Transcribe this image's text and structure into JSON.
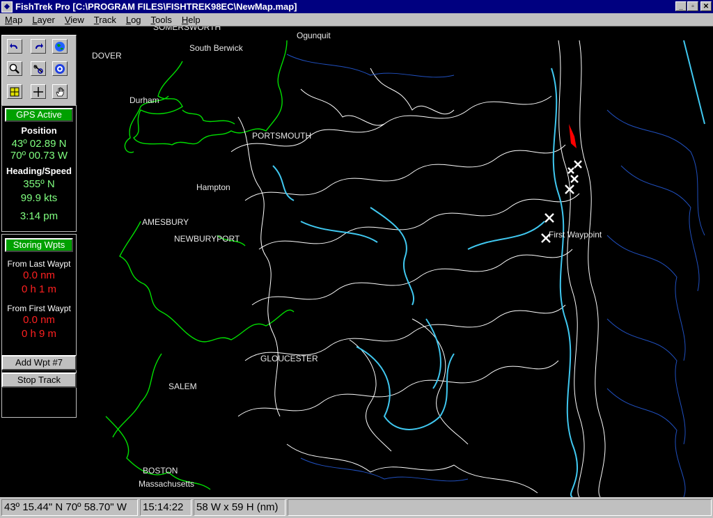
{
  "window": {
    "title": "FishTrek Pro [C:\\PROGRAM FILES\\FISHTREK98EC\\NewMap.map]",
    "minimize": "_",
    "maximize": "▫",
    "close": "✕"
  },
  "menu": [
    {
      "label": "Map",
      "u": "M",
      "rest": "ap"
    },
    {
      "label": "Layer",
      "u": "L",
      "rest": "ayer"
    },
    {
      "label": "View",
      "u": "V",
      "rest": "iew"
    },
    {
      "label": "Track",
      "u": "T",
      "rest": "rack"
    },
    {
      "label": "Log",
      "u": "L",
      "rest": "og"
    },
    {
      "label": "Tools",
      "u": "T",
      "rest": "ools"
    },
    {
      "label": "Help",
      "u": "H",
      "rest": "elp"
    }
  ],
  "gps": {
    "status": "GPS Active",
    "position_label": "Position",
    "lat": "43º 02.89 N",
    "lon": "70º 00.73 W",
    "heading_label": "Heading/Speed",
    "heading": "355º  N",
    "speed": "99.9 kts",
    "time": "3:14 pm"
  },
  "waypoints": {
    "status": "Storing Wpts",
    "from_last_label": "From Last Waypt",
    "from_last_dist": "0.0 nm",
    "from_last_time": "0 h 1 m",
    "from_first_label": "From First Waypt",
    "from_first_dist": "0.0 nm",
    "from_first_time": "0 h 9 m",
    "add_button": "Add Wpt #7",
    "stop_button": "Stop Track"
  },
  "map_labels": {
    "somersworth": "SOMERSWORTH",
    "ogunquit": "Ogunquit",
    "dover": "DOVER",
    "south_berwick": "South Berwick",
    "durham": "Durham",
    "portsmouth": "PORTSMOUTH",
    "hampton": "Hampton",
    "amesbury": "AMESBURY",
    "newburyport": "NEWBURYPORT",
    "first_waypoint": "First Waypoint",
    "gloucester": "GLOUCESTER",
    "salem": "SALEM",
    "boston": "BOSTON",
    "massachusetts": "Massachusetts"
  },
  "statusbar": {
    "cursor_pos": "43º 15.44\" N 70º 58.70\" W",
    "clock": "15:14:22",
    "extent": "58 W x 59 H (nm)"
  },
  "colors": {
    "titlebar": "#000080",
    "land": "#00e000",
    "contour_white": "#ffffff",
    "contour_cyan": "#40c8f0",
    "contour_blue": "#2050c0",
    "track_marker": "#ff0000"
  }
}
